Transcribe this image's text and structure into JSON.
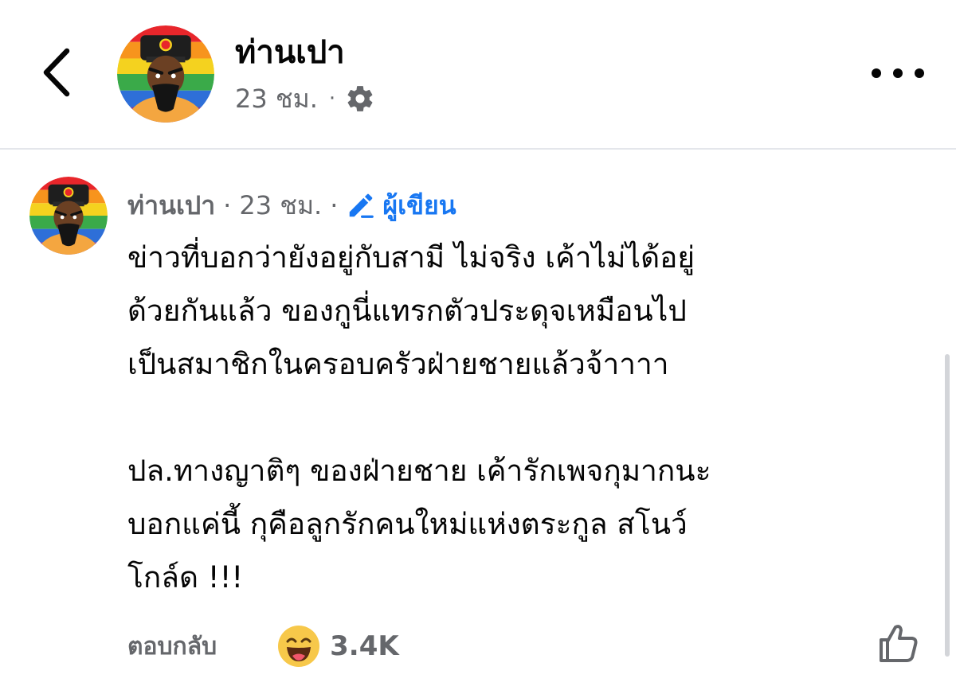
{
  "header": {
    "name": "ท่านเปา",
    "time": "23 ชม.",
    "separator": "·"
  },
  "comment": {
    "author": "ท่านเปา",
    "time": "23 ชม.",
    "separator": "·",
    "author_badge": "ผู้เขียน",
    "lines": [
      "ข่าวที่บอกว่ายังอยู่กับสามี ไม่จริง เค้าไม่ได้อยู่",
      "ด้วยกันแล้ว ของกูนี่แทรกตัวประดุจเหมือนไป",
      "เป็นสมาชิกในครอบครัวฝ่ายชายแล้วจ้าาาา",
      "ปล.ทางญาติๆ ของฝ่ายชาย เค้ารักเพจกุมากนะ",
      "บอกแค่นี้  กุคือลูกรักคนใหม่แห่งตระกูล สโนว์",
      "โกล์ด !!!"
    ],
    "reply_label": "ตอบกลับ",
    "reaction_count": "3.4K"
  },
  "icons": {
    "back": "chevron-left-icon",
    "settings": "gear-icon",
    "more": "more-dots-icon",
    "author_badge": "pencil-icon",
    "reaction": "haha-emoji-icon",
    "like": "thumbs-up-icon"
  },
  "colors": {
    "accent": "#1877f2",
    "secondary_text": "#65676b",
    "primary_text": "#050505",
    "divider": "#e4e6eb"
  }
}
